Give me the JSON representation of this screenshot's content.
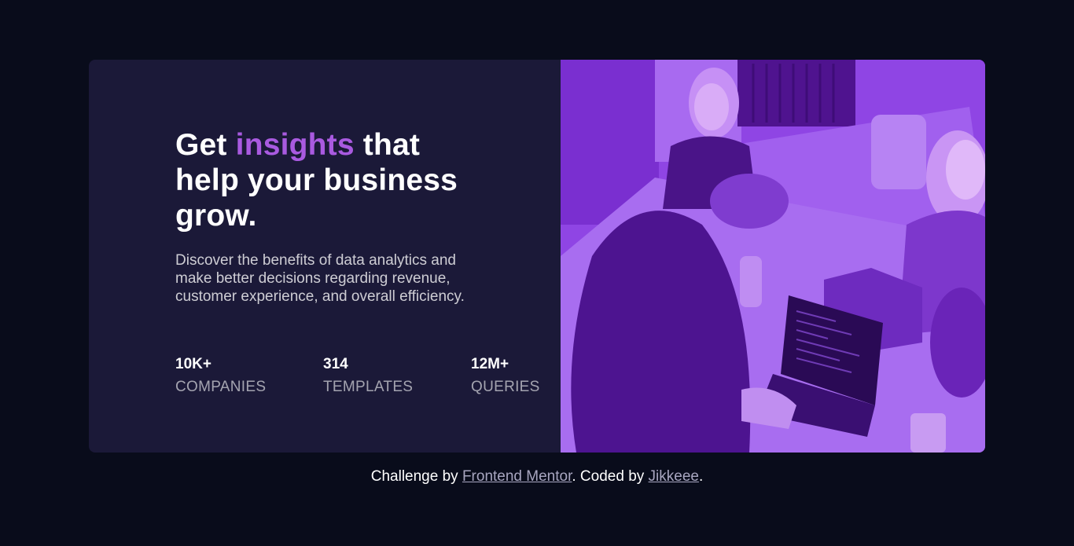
{
  "hero": {
    "headline": {
      "part1": "Get ",
      "accent": "insights",
      "part2": " that help your business grow."
    },
    "description": "Discover the benefits of data analytics and make better decisions regarding revenue, customer experience, and overall efficiency.",
    "stats": [
      {
        "value": "10K+",
        "label": "COMPANIES"
      },
      {
        "value": "314",
        "label": "TEMPLATES"
      },
      {
        "value": "12M+",
        "label": "QUERIES"
      }
    ],
    "image": "people-working-at-desk-photo"
  },
  "footer": {
    "prefix": "Challenge by ",
    "link1": "Frontend Mentor",
    "middle": ". Coded by ",
    "link2": "Jikkeee",
    "suffix": "."
  },
  "colors": {
    "page_background": "#090c1b",
    "card_background": "#1b1938",
    "accent": "#a95ae0",
    "photo_overlay": "#8d3de6"
  }
}
